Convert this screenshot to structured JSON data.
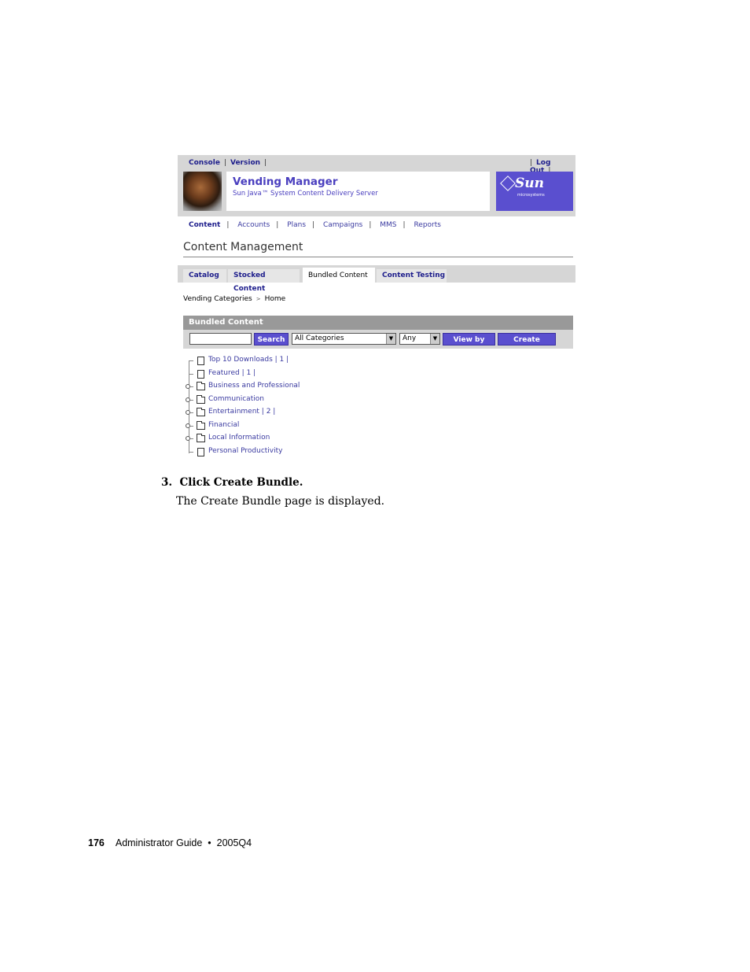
{
  "header_links": {
    "console": "Console",
    "version": "Version",
    "logout": "Log Out"
  },
  "brand": {
    "title": "Vending Manager",
    "subtitle": "Sun Java™ System Content Delivery Server",
    "logo": "Sun",
    "logo_tag": "microsystems"
  },
  "nav": [
    "Content",
    "Accounts",
    "Plans",
    "Campaigns",
    "MMS",
    "Reports"
  ],
  "page_title": "Content Management",
  "tabs": [
    "Catalog",
    "Stocked Content",
    "Bundled Content",
    "Content Testing"
  ],
  "breadcrumb": {
    "root": "Vending Categories",
    "current": "Home"
  },
  "bundled": {
    "heading": "Bundled Content",
    "search_value": "",
    "search_button": "Search",
    "category_select": "All Categories",
    "any_select": "Any",
    "view_by_title": "View by Title",
    "create_bundle": "Create Bundle"
  },
  "tree": [
    {
      "label": "Top 10 Downloads | 1 |",
      "kind": "doc"
    },
    {
      "label": "Featured | 1 |",
      "kind": "doc"
    },
    {
      "label": "Business and Professional",
      "kind": "folder"
    },
    {
      "label": "Communication",
      "kind": "folder"
    },
    {
      "label": "Entertainment | 2 |",
      "kind": "folder"
    },
    {
      "label": "Financial",
      "kind": "folder"
    },
    {
      "label": "Local Information",
      "kind": "folder"
    },
    {
      "label": "Personal Productivity",
      "kind": "doc"
    }
  ],
  "step": {
    "number": "3.",
    "text": "Click Create Bundle.",
    "result": "The Create Bundle page is displayed."
  },
  "footer": {
    "page_number": "176",
    "title": "Administrator Guide",
    "bullet": "•",
    "version": "2005Q4"
  },
  "colors": {
    "accent": "#5a4fcf",
    "link": "#3a3aa0",
    "bar": "#d6d6d6",
    "header_gray": "#999999"
  }
}
